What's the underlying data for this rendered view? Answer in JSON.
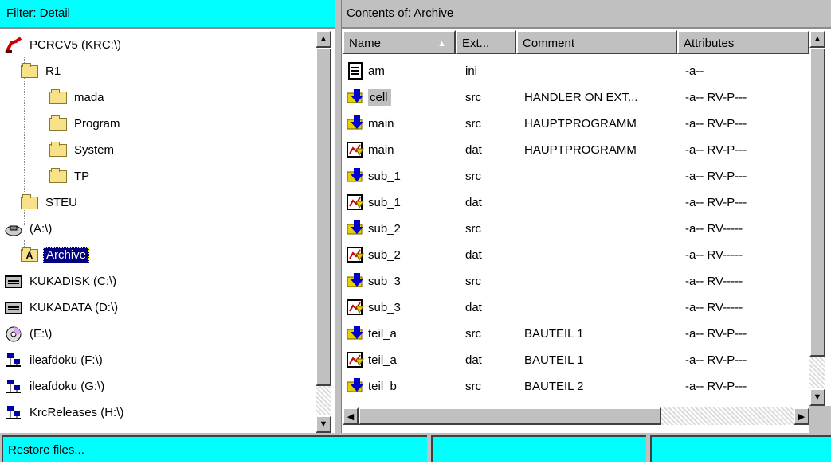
{
  "left_pane": {
    "header": "Filter: Detail",
    "tree": [
      {
        "label": "PCRCV5 (KRC:\\)",
        "icon": "robot-icon",
        "selected": false
      },
      {
        "label": "R1",
        "icon": "folder-icon",
        "selected": false
      },
      {
        "label": "mada",
        "icon": "folder-icon",
        "selected": false
      },
      {
        "label": "Program",
        "icon": "folder-icon",
        "selected": false
      },
      {
        "label": "System",
        "icon": "folder-icon",
        "selected": false
      },
      {
        "label": "TP",
        "icon": "folder-icon",
        "selected": false
      },
      {
        "label": "STEU",
        "icon": "folder-icon",
        "selected": false
      },
      {
        "label": "(A:\\)",
        "icon": "floppy-drive-icon",
        "selected": false
      },
      {
        "label": "Archive",
        "icon": "archive-folder-icon",
        "selected": true
      },
      {
        "label": "KUKADISK (C:\\)",
        "icon": "hard-drive-icon",
        "selected": false
      },
      {
        "label": "KUKADATA (D:\\)",
        "icon": "hard-drive-icon",
        "selected": false
      },
      {
        "label": "(E:\\)",
        "icon": "cd-drive-icon",
        "selected": false
      },
      {
        "label": "ileafdoku (F:\\)",
        "icon": "network-drive-icon",
        "selected": false
      },
      {
        "label": "ileafdoku (G:\\)",
        "icon": "network-drive-icon",
        "selected": false
      },
      {
        "label": "KrcReleases (H:\\)",
        "icon": "network-drive-icon",
        "selected": false
      }
    ],
    "archive_icon_letter": "A"
  },
  "right_pane": {
    "header": "Contents of: Archive",
    "columns": [
      "Name",
      "Ext...",
      "Comment",
      "Attributes"
    ],
    "sort_indicator": "▲",
    "files": [
      {
        "name": "am",
        "ext": "ini",
        "comment": "",
        "attributes": "-a--",
        "icon": "ini-file-icon"
      },
      {
        "name": "cell",
        "ext": "src",
        "comment": "HANDLER ON EXT...",
        "attributes": "-a-- RV-P---",
        "icon": "src-file-icon"
      },
      {
        "name": "main",
        "ext": "src",
        "comment": "HAUPTPROGRAMM",
        "attributes": "-a-- RV-P---",
        "icon": "src-file-icon"
      },
      {
        "name": "main",
        "ext": "dat",
        "comment": "HAUPTPROGRAMM",
        "attributes": "-a-- RV-P---",
        "icon": "dat-file-icon"
      },
      {
        "name": "sub_1",
        "ext": "src",
        "comment": "",
        "attributes": "-a-- RV-P---",
        "icon": "src-file-icon"
      },
      {
        "name": "sub_1",
        "ext": "dat",
        "comment": "",
        "attributes": "-a-- RV-P---",
        "icon": "dat-file-icon"
      },
      {
        "name": "sub_2",
        "ext": "src",
        "comment": "",
        "attributes": "-a-- RV-----",
        "icon": "src-file-icon"
      },
      {
        "name": "sub_2",
        "ext": "dat",
        "comment": "",
        "attributes": "-a-- RV-----",
        "icon": "dat-file-icon"
      },
      {
        "name": "sub_3",
        "ext": "src",
        "comment": "",
        "attributes": "-a-- RV-----",
        "icon": "src-file-icon"
      },
      {
        "name": "sub_3",
        "ext": "dat",
        "comment": "",
        "attributes": "-a-- RV-----",
        "icon": "dat-file-icon"
      },
      {
        "name": "teil_a",
        "ext": "src",
        "comment": "BAUTEIL 1",
        "attributes": "-a-- RV-P---",
        "icon": "src-file-icon"
      },
      {
        "name": "teil_a",
        "ext": "dat",
        "comment": "BAUTEIL 1",
        "attributes": "-a-- RV-P---",
        "icon": "dat-file-icon"
      },
      {
        "name": "teil_b",
        "ext": "src",
        "comment": "BAUTEIL 2",
        "attributes": "-a-- RV-P---",
        "icon": "src-file-icon"
      }
    ]
  },
  "status_bar": {
    "message": "Restore files...",
    "segment2": "",
    "segment3": ""
  },
  "colors": {
    "header_active": "#00ffff",
    "header_inactive": "#c0c0c0",
    "selection": "#000080"
  }
}
